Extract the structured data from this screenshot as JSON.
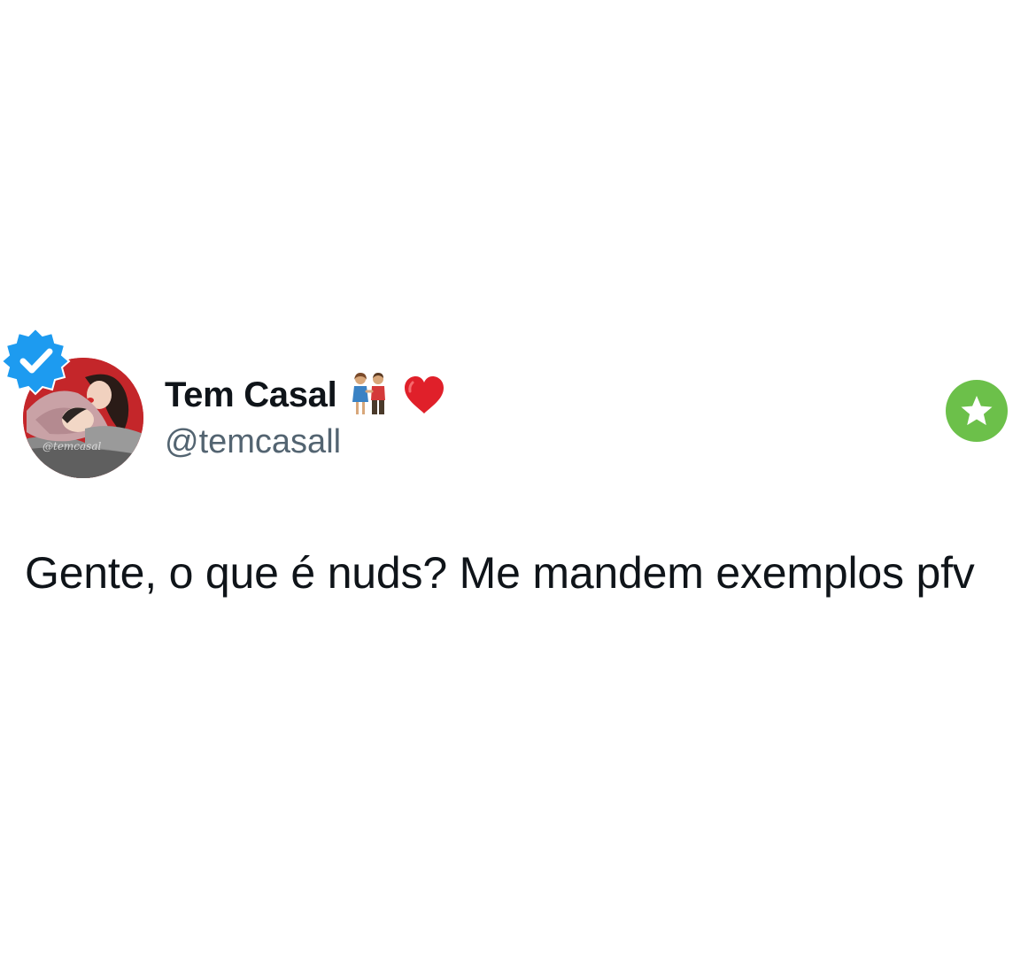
{
  "author": {
    "display_name": "Tem Casal",
    "name_emojis": [
      "couple-holding-hands-icon",
      "red-heart-icon"
    ],
    "handle": "@temcasall",
    "verified": true,
    "avatar_watermark": "@temcasal"
  },
  "tweet": {
    "text": "Gente, o que é nuds? Me mandem exemplos pfv"
  },
  "colors": {
    "verified_blue": "#1d9bf0",
    "favorite_green": "#6cc04a",
    "avatar_red": "#c4262a",
    "handle_gray": "#536471",
    "text": "#0f1419"
  }
}
